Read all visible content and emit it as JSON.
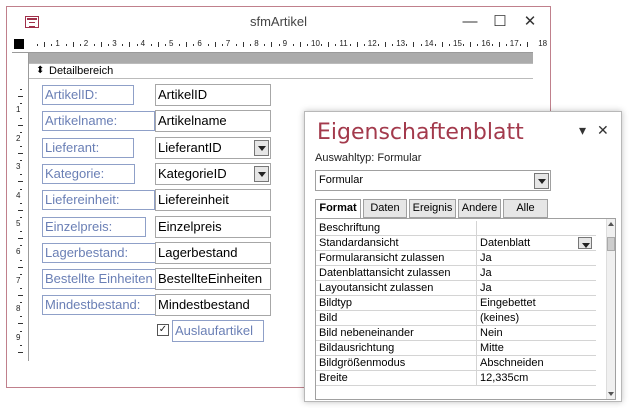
{
  "window": {
    "title": "sfmArtikel",
    "minimize": "—",
    "maximize": "☐",
    "close": "✕"
  },
  "ruler": {
    "top_numbers": [
      "1",
      "2",
      "3",
      "4",
      "5",
      "6",
      "7",
      "8",
      "9",
      "10",
      "11",
      "12",
      "13",
      "14",
      "15",
      "16",
      "17",
      "18"
    ],
    "left_numbers": [
      "1",
      "2",
      "3",
      "4",
      "5",
      "6",
      "7",
      "8",
      "9",
      "10"
    ]
  },
  "section": {
    "label": "Detailbereich"
  },
  "fields": [
    {
      "label": "ArtikelID:",
      "control": "ArtikelID",
      "dropdown": false
    },
    {
      "label": "Artikelname:",
      "control": "Artikelname",
      "dropdown": false
    },
    {
      "label": "Lieferant:",
      "control": "LieferantID",
      "dropdown": true
    },
    {
      "label": "Kategorie:",
      "control": "KategorieID",
      "dropdown": true
    },
    {
      "label": "Liefereinheit:",
      "control": "Liefereinheit",
      "dropdown": false
    },
    {
      "label": "Einzelpreis:",
      "control": "Einzelpreis",
      "dropdown": false
    },
    {
      "label": "Lagerbestand:",
      "control": "Lagerbestand",
      "dropdown": false
    },
    {
      "label": "Bestellte Einheiten",
      "control": "BestellteEinheiten",
      "dropdown": false
    },
    {
      "label": "Mindestbestand:",
      "control": "Mindestbestand",
      "dropdown": false
    }
  ],
  "checkbox": {
    "label": "Auslaufartikel",
    "checked_mark": "✓"
  },
  "property_sheet": {
    "title": "Eigenschaftenblatt",
    "selection_type_label": "Auswahltyp:",
    "selection_type_value": "Formular",
    "object_selected": "Formular",
    "pin": "▾",
    "close": "✕",
    "tabs": [
      {
        "label": "Format",
        "active": true
      },
      {
        "label": "Daten",
        "active": false
      },
      {
        "label": "Ereignis",
        "active": false
      },
      {
        "label": "Andere",
        "active": false
      },
      {
        "label": "Alle",
        "active": false
      }
    ],
    "properties": [
      {
        "name": "Beschriftung",
        "value": ""
      },
      {
        "name": "Standardansicht",
        "value": "Datenblatt",
        "dropdown": true
      },
      {
        "name": "Formularansicht zulassen",
        "value": "Ja"
      },
      {
        "name": "Datenblattansicht zulassen",
        "value": "Ja"
      },
      {
        "name": "Layoutansicht zulassen",
        "value": "Ja"
      },
      {
        "name": "Bildtyp",
        "value": "Eingebettet"
      },
      {
        "name": "Bild",
        "value": "(keines)"
      },
      {
        "name": "Bild nebeneinander",
        "value": "Nein"
      },
      {
        "name": "Bildausrichtung",
        "value": "Mitte"
      },
      {
        "name": "Bildgrößenmodus",
        "value": "Abschneiden"
      },
      {
        "name": "Breite",
        "value": "12,335cm"
      }
    ]
  }
}
